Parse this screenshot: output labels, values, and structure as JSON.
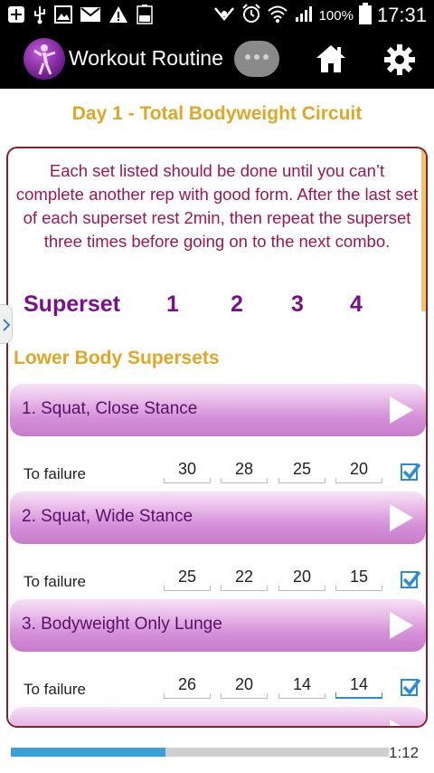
{
  "status_bar": {
    "battery_percent": "100%",
    "time": "17:31",
    "left_icons": [
      "add-icon",
      "usb-icon",
      "image-icon",
      "mail-icon",
      "warning-icon",
      "battery-full-icon"
    ],
    "right_icons": [
      "nfc-icon",
      "alarm-icon",
      "wifi-icon",
      "signal-icon",
      "battery-icon"
    ]
  },
  "action_bar": {
    "title": "Workout Routine",
    "icons": [
      "app-logo-icon",
      "overflow-icon",
      "home-icon",
      "gear-icon"
    ]
  },
  "day_title": "Day 1 - Total Bodyweight Circuit",
  "description": "Each set listed should be done until you can’t complete another rep with good form. After the last set of each superset rest 2min, then repeat the superset three times before going on to the next combo.",
  "superset_header": {
    "label": "Superset",
    "sets": [
      "1",
      "2",
      "3",
      "4"
    ]
  },
  "section_title": "Lower Body Supersets",
  "exercises": [
    {
      "name": "1. Squat, Close Stance",
      "rep_label": "To failure",
      "reps": [
        "30",
        "28",
        "25",
        "20"
      ],
      "checked": true
    },
    {
      "name": "2. Squat, Wide Stance",
      "rep_label": "To failure",
      "reps": [
        "25",
        "22",
        "20",
        "15"
      ],
      "checked": true
    },
    {
      "name": "3. Bodyweight Only Lunge",
      "rep_label": "To failure",
      "reps": [
        "26",
        "20",
        "14",
        "14"
      ],
      "checked": true
    }
  ],
  "progress": {
    "fraction": 0.41,
    "time_remaining": "1:12"
  },
  "colors": {
    "accent_gold": "#e0a626",
    "description_text": "#a2154c",
    "superset_purple": "#7a0f8c",
    "checkbox_blue": "#2b8cd1"
  }
}
